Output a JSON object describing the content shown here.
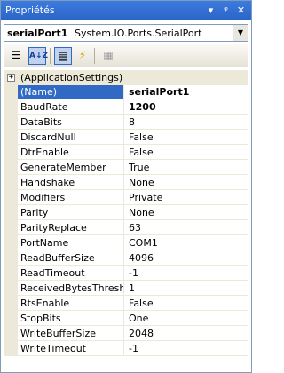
{
  "window": {
    "title": "Propriétés",
    "buttons": {
      "dropdown": "▾",
      "pin": "ᵠ",
      "close": "✕"
    }
  },
  "object_selector": {
    "name": "serialPort1",
    "type": "System.IO.Ports.SerialPort",
    "dropdown_icon": "chevron-down-icon"
  },
  "toolbar": {
    "buttons": [
      {
        "name": "categorized-button",
        "icon": "categorized-icon",
        "glyph": "☰",
        "active": false
      },
      {
        "name": "alphabetical-button",
        "icon": "sort-az-icon",
        "glyph": "A↓Z",
        "active": true
      },
      {
        "name": "properties-button",
        "icon": "properties-icon",
        "glyph": "▤",
        "active": true
      },
      {
        "name": "events-button",
        "icon": "lightning-icon",
        "glyph": "⚡",
        "active": false
      },
      {
        "name": "property-pages-button",
        "icon": "property-pages-icon",
        "glyph": "▦",
        "active": false
      }
    ]
  },
  "grid": {
    "category": {
      "expander": "+",
      "label": "(ApplicationSettings)"
    },
    "properties": [
      {
        "name": "(Name)",
        "value": "serialPort1",
        "bold": true,
        "selected": true
      },
      {
        "name": "BaudRate",
        "value": "1200",
        "bold": true
      },
      {
        "name": "DataBits",
        "value": "8"
      },
      {
        "name": "DiscardNull",
        "value": "False"
      },
      {
        "name": "DtrEnable",
        "value": "False"
      },
      {
        "name": "GenerateMember",
        "value": "True"
      },
      {
        "name": "Handshake",
        "value": "None"
      },
      {
        "name": "Modifiers",
        "value": "Private"
      },
      {
        "name": "Parity",
        "value": "None"
      },
      {
        "name": "ParityReplace",
        "value": "63"
      },
      {
        "name": "PortName",
        "value": "COM1"
      },
      {
        "name": "ReadBufferSize",
        "value": "4096"
      },
      {
        "name": "ReadTimeout",
        "value": "-1"
      },
      {
        "name": "ReceivedBytesThreshold",
        "value": "1"
      },
      {
        "name": "RtsEnable",
        "value": "False"
      },
      {
        "name": "StopBits",
        "value": "One"
      },
      {
        "name": "WriteBufferSize",
        "value": "2048"
      },
      {
        "name": "WriteTimeout",
        "value": "-1"
      }
    ]
  },
  "colors": {
    "titlebar": "#2a64c8",
    "selection": "#316ac5",
    "gutter": "#ece9d8"
  }
}
